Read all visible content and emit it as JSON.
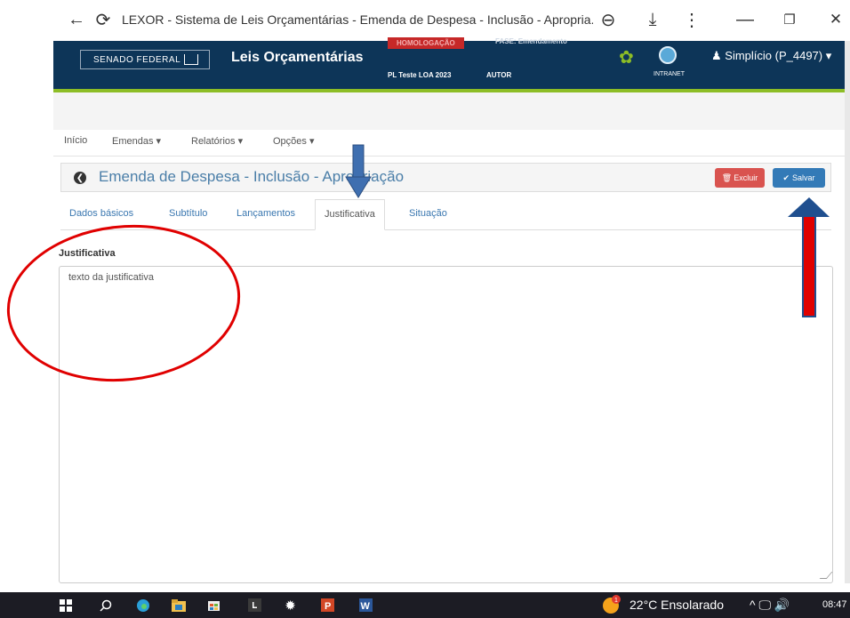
{
  "browser": {
    "back_glyph": "←",
    "reload_glyph": "⟳",
    "title": "LEXOR - Sistema de Leis Orçamentárias - Emenda de Despesa - Inclusão - Apropria...",
    "zoom_glyph": "⊖",
    "download_glyph": "⤓",
    "menu_glyph": "⋮",
    "minimize_glyph": "—",
    "restore_glyph": "❐",
    "close_glyph": "✕"
  },
  "header": {
    "senado": "SENADO FEDERAL",
    "app_name": "Leis Orçamentárias",
    "homologacao": "HOMOLOGAÇÃO",
    "fase": "FASE: Emendamento",
    "pl": "PL Teste LOA 2023",
    "autor": "AUTOR",
    "intranet": "INTRANET",
    "user": "Simplício (P_4497)",
    "gear_glyph": "✿"
  },
  "nav": {
    "inicio": "Início",
    "emendas": "Emendas ▾",
    "relatorios": "Relatórios ▾",
    "opcoes": "Opções ▾"
  },
  "panel": {
    "back_glyph": "❮",
    "title": "Emenda de Despesa - Inclusão - Apropriação",
    "excluir": "Excluir",
    "excluir_glyph": "🗑",
    "salvar": "Salvar",
    "salvar_glyph": "✔"
  },
  "tabs": [
    "Dados básicos",
    "Subtítulo",
    "Lançamentos",
    "Justificativa",
    "Situação"
  ],
  "form": {
    "label": "Justificativa",
    "value": "texto da justificativa"
  },
  "taskbar": {
    "weather": "22°C  Ensolarado",
    "tray_icons": "^  🖵  🔊",
    "time": "08:47",
    "notification_count": "1"
  },
  "colors": {
    "header_bg": "#0d3558",
    "accent_green": "#8dbd26",
    "primary": "#337ab7",
    "danger": "#d9534f",
    "annotation_red": "#e00000",
    "annotation_blue": "#3f6fb0"
  }
}
